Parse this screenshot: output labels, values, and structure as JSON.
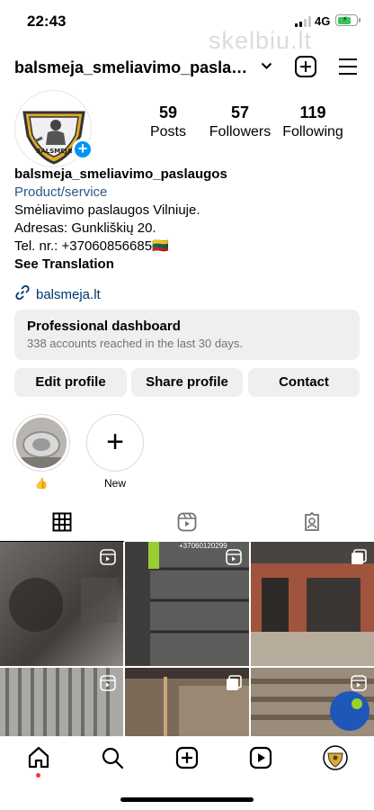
{
  "status_bar": {
    "time": "22:43",
    "network": "4G"
  },
  "watermark": "skelbiu.lt",
  "header": {
    "username": "balsmeja_smeliavimo_paslaugos"
  },
  "avatar": {
    "brand_text": "BALSMEJA"
  },
  "stats": [
    {
      "value": "59",
      "label": "Posts"
    },
    {
      "value": "57",
      "label": "Followers"
    },
    {
      "value": "119",
      "label": "Following"
    }
  ],
  "bio": {
    "name": "balsmeja_smeliavimo_paslaugos",
    "category": "Product/service",
    "lines": [
      "Smėliavimo paslaugos Vilniuje.",
      "Adresas: Gunkliškių 20.",
      "Tel. nr.: +37060856685🇱🇹"
    ],
    "see_translation": "See Translation",
    "link": "balsmeja.lt"
  },
  "dashboard": {
    "title": "Professional dashboard",
    "subtitle": "338 accounts reached in the last 30 days."
  },
  "buttons": {
    "edit": "Edit profile",
    "share": "Share profile",
    "contact": "Contact"
  },
  "highlights": [
    {
      "label": "👍"
    },
    {
      "label": "New"
    }
  ],
  "grid_overlay_text": "+37060120299",
  "colors": {
    "accent": "#0095f6",
    "link": "#00376b",
    "notification": "#ff3040"
  }
}
